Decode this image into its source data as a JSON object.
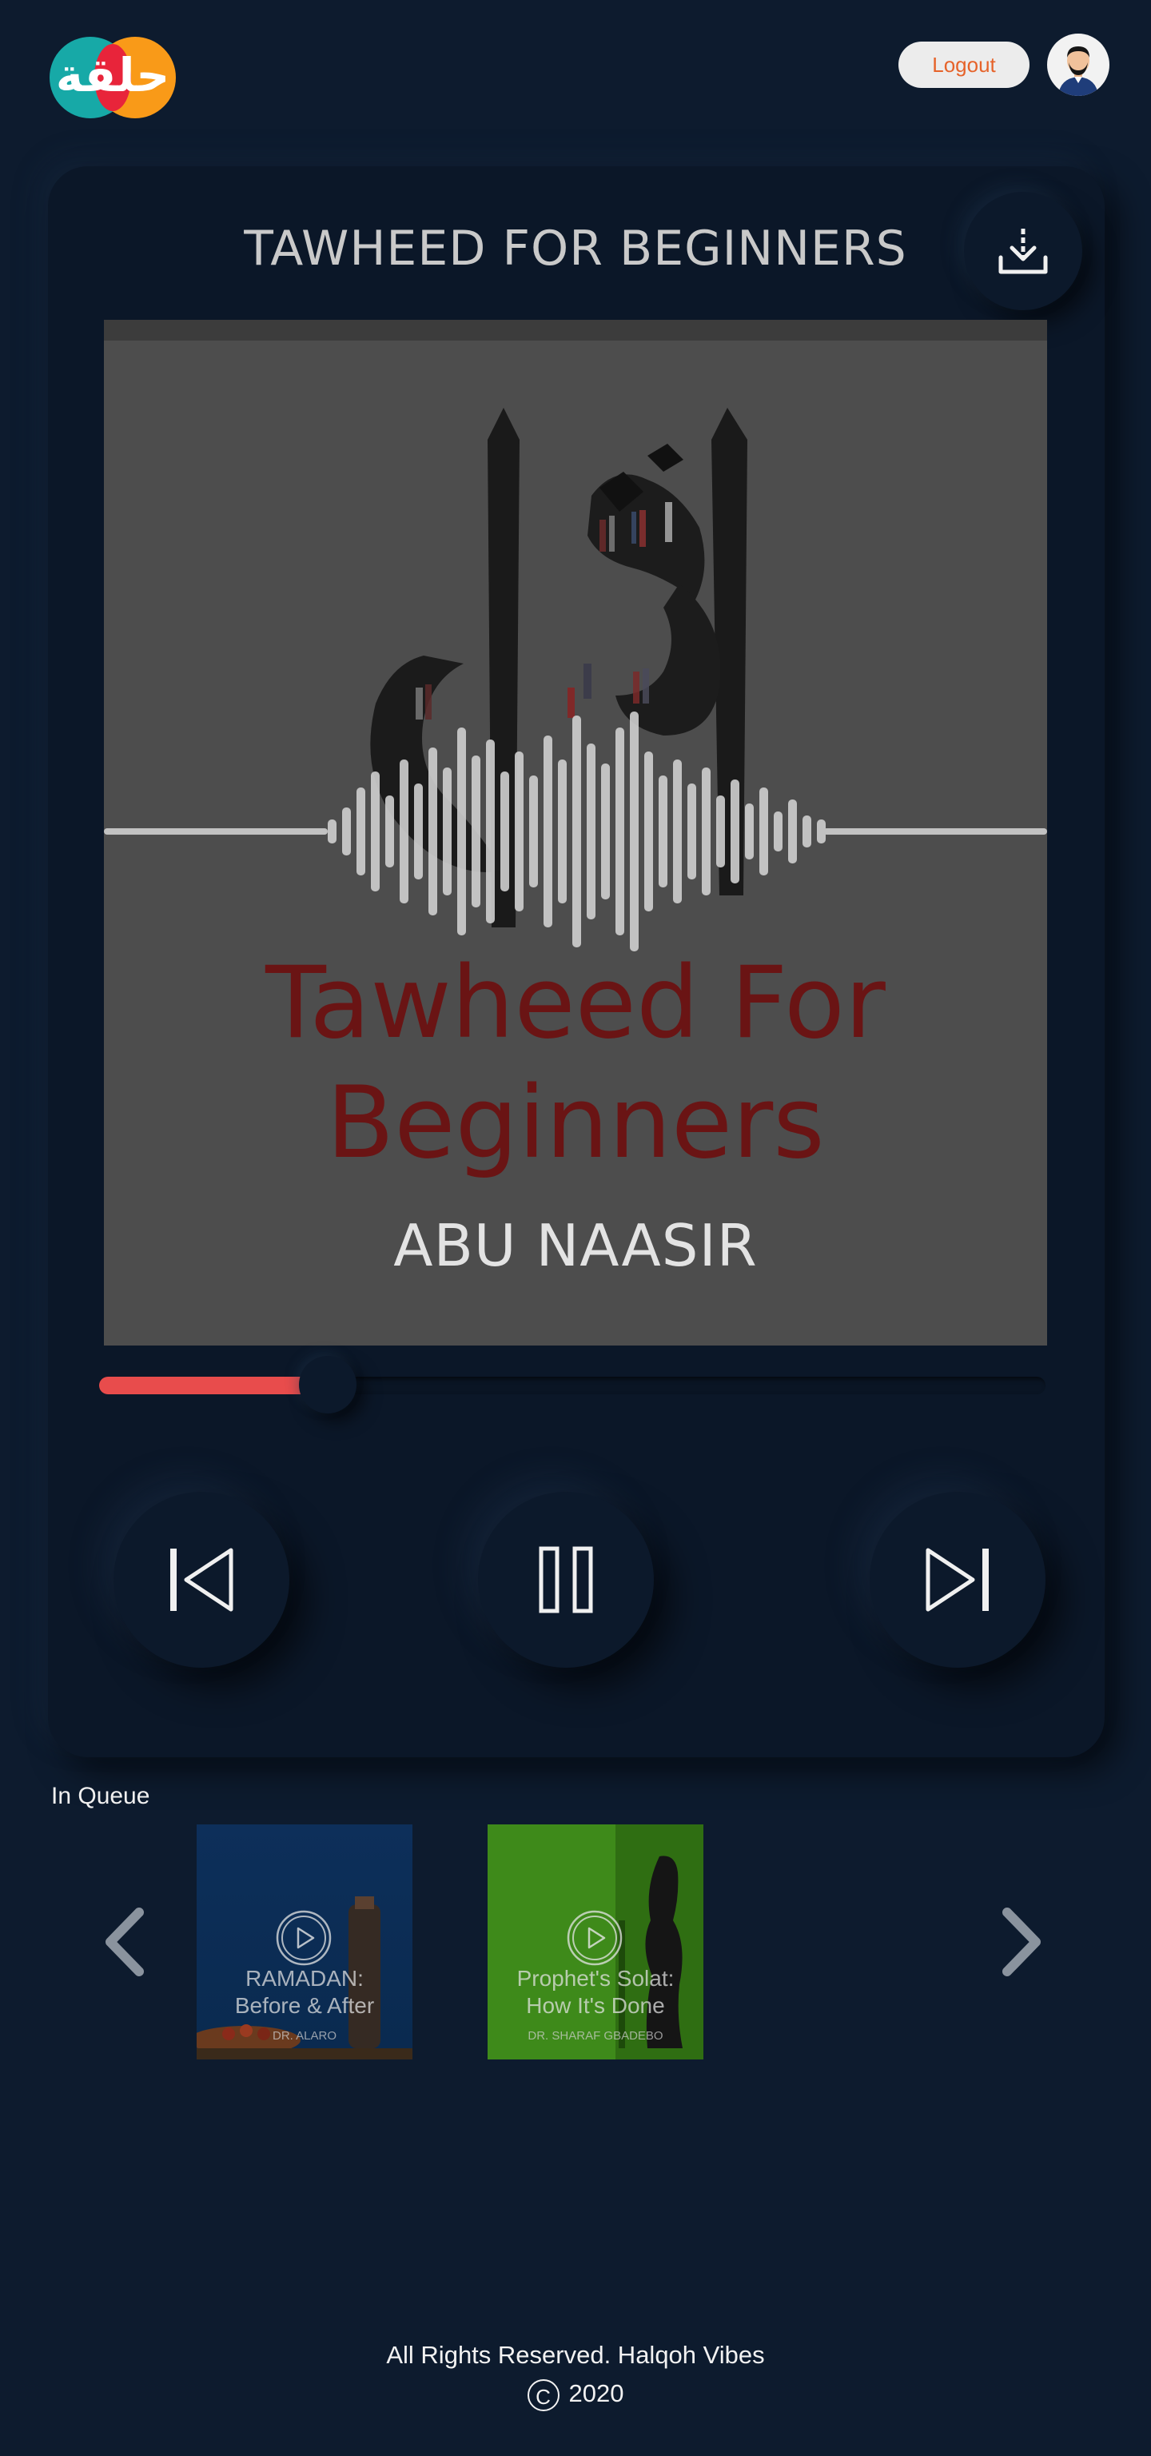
{
  "header": {
    "logo_text": "حلقة",
    "logout_label": "Logout"
  },
  "player": {
    "title": "TAWHEED FOR BEGINNERS",
    "cover_title_line1": "Tawheed For",
    "cover_title_line2": "Beginners",
    "cover_speaker": "ABU NAASIR",
    "progress": 0.22,
    "colors": {
      "accent": "#e84c4c",
      "background": "#0d1b2e",
      "card": "#0b1728",
      "cover_title": "#6a1414"
    }
  },
  "queue": {
    "label": "In Queue",
    "items": [
      {
        "title_line1": "RAMADAN:",
        "title_line2": "Before & After",
        "author": "DR. ALARO"
      },
      {
        "title_line1": "Prophet's Solat:",
        "title_line2": "How It's Done",
        "author": "DR. SHARAF GBADEBO"
      }
    ]
  },
  "footer": {
    "rights": "All Rights Reserved. Halqoh Vibes",
    "copyright_symbol": "C",
    "year": "2020"
  }
}
